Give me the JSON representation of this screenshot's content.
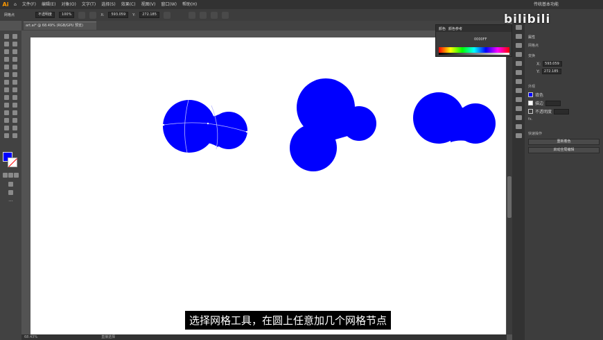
{
  "menubar": {
    "logo": "Ai",
    "items": [
      "文件(F)",
      "编辑(E)",
      "对象(O)",
      "文字(T)",
      "选择(S)",
      "效果(C)",
      "视图(V)",
      "窗口(W)",
      "帮助(H)"
    ],
    "right_label": "传统基本功能"
  },
  "control_bar": {
    "tool_name": "网格点",
    "opacity_label": "不透明度",
    "opacity_value": "100%",
    "x_value": "593.059",
    "y_value": "272.185",
    "align_label": "对齐"
  },
  "document": {
    "tab": "art.ai* @ 68.49% (RGB/GPU 预览)",
    "zoom": "68.43%",
    "status": "直接选择"
  },
  "color_panel": {
    "tabs": [
      "颜色",
      "颜色参考"
    ],
    "hex": "0000FF"
  },
  "properties": {
    "title": "属性",
    "section_mesh": "网格点",
    "section_transform": "变换",
    "x_label": "X:",
    "x_value": "593.059",
    "y_label": "Y:",
    "y_value": "272.185",
    "section_appearance": "外观",
    "fill_label": "填色",
    "stroke_label": "描边",
    "opacity_label": "不透明度",
    "fx_label": "fx.",
    "section_quick": "快速操作",
    "btn_recolor": "重新着色",
    "btn_global": "启动全局编辑"
  },
  "colors": {
    "blob_fill": "#0000ff",
    "artboard": "#ffffff",
    "ui_bg": "#535353"
  },
  "watermark": "bilibili",
  "subtitle": "选择网格工具，在圆上任意加几个网格节点"
}
